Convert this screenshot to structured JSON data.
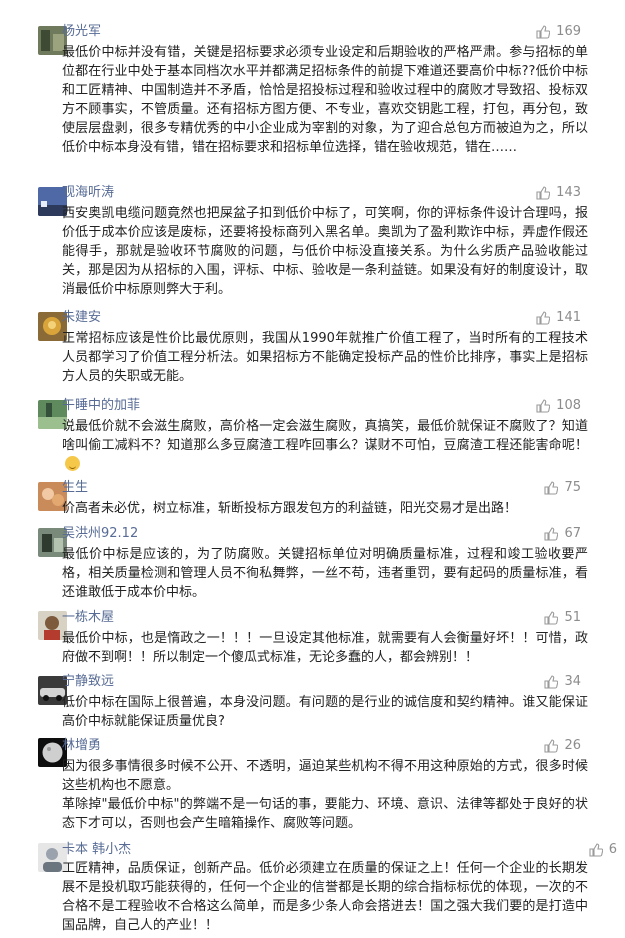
{
  "comments": [
    {
      "user": "杨光军",
      "likes": "169",
      "text": "最低价中标并没有错，关键是招标要求必须专业设定和后期验收的严格严肃。参与招标的单位都在行业中处于基本同档次水平并都满足招标条件的前提下难道还要高价中标??低价中标和工匠精神、中国制造并不矛盾，恰恰是招投标过程和验收过程中的腐败才导致招、投标双方不顾事实，不管质量。还有招标方图方便、不专业，喜欢交钥匙工程，打包，再分包，致使层层盘剥，很多专精优秀的中小企业成为宰割的对象，为了迎合总包方而被迫为之，所以低价中标本身没有错，错在招标要求和招标单位选择，错在验收规范，错在……"
    },
    {
      "user": "观海听涛",
      "likes": "143",
      "text": "西安奥凯电缆问题竟然也把屎盆子扣到低价中标了，可笑啊，你的评标条件设计合理吗，报价低于成本价应该是废标，还要将投标商列入黑名单。奥凯为了盈利欺诈中标，弄虚作假还能得手，那就是验收环节腐败的问题，与低价中标没直接关系。为什么劣质产品验收能过关，那是因为从招标的入围，评标、中标、验收是一条利益链。如果没有好的制度设计，取消最低价中标原则弊大于利。"
    },
    {
      "user": "朱建安",
      "likes": "141",
      "text": "正常招标应该是性价比最优原则，我国从1990年就推广价值工程了，当时所有的工程技术人员都学习了价值工程分析法。如果招标方不能确定投标产品的性价比排序，事实上是招标方人员的失职或无能。"
    },
    {
      "user": "午睡中的加菲",
      "likes": "108",
      "text": "说最低价就不会滋生腐败，高价格一定会滋生腐败，真搞笑，最低价就保证不腐败了？知道啥叫偷工减料不？知道那么多豆腐渣工程咋回事么？谋财不可怕，豆腐渣工程还能害命呢！"
    },
    {
      "user": "生生",
      "likes": "75",
      "text": "价高者未必优，树立标准，斩断投标方跟发包方的利益链，阳光交易才是出路！"
    },
    {
      "user": "吴洪州92.12",
      "likes": "67",
      "text": "最低价中标是应该的，为了防腐败。关键招标单位对明确质量标准，过程和竣工验收要严格，相关质量检测和管理人员不徇私舞弊，一丝不苟，违者重罚，要有起码的质量标准，看还谁敢低于成本价中标。"
    },
    {
      "user": "一栋木屋",
      "likes": "51",
      "text": "最低价中标，也是惰政之一！！！一旦设定其他标准，就需要有人会衡量好坏！！可惜，政府做不到啊！！所以制定一个傻瓜式标准，无论多蠢的人，都会辨别！！"
    },
    {
      "user": "宁静致远",
      "likes": "34",
      "text": "低价中标在国际上很普遍，本身没问题。有问题的是行业的诚信度和契约精神。谁又能保证高价中标就能保证质量优良?"
    },
    {
      "user": "林增勇",
      "likes": "26",
      "text": "因为很多事情很多时候不公开、不透明，逼迫某些机构不得不用这种原始的方式，很多时候这些机构也不愿意。",
      "text2": "革除掉\"最低价中标\"的弊端不是一句话的事，要能力、环境、意识、法律等都处于良好的状态下才可以，否则也会产生暗箱操作、腐败等问题。"
    },
    {
      "user": "卡本 韩小杰",
      "likes": "6",
      "text": "工匠精神，品质保证，创新产品。低价必须建立在质量的保证之上！任何一个企业的长期发展不是投机取巧能获得的，任何一个企业的信誉都是长期的综合指标标优的体现，一次的不合格不是工程验收不合格这么简单，而是多少条人命会搭进去！国之强大我们要的是打造中国品牌，自己人的产业！！"
    }
  ]
}
